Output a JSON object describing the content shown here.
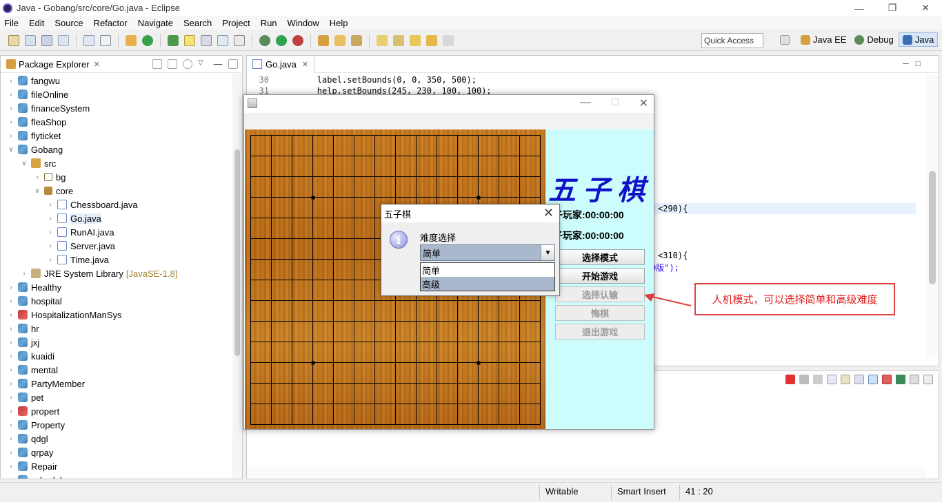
{
  "window": {
    "title": "Java - Gobang/src/core/Go.java - Eclipse"
  },
  "menubar": {
    "items": [
      "File",
      "Edit",
      "Source",
      "Refactor",
      "Navigate",
      "Search",
      "Project",
      "Run",
      "Window",
      "Help"
    ]
  },
  "toolbar": {
    "quick_access": "Quick Access",
    "perspectives": [
      "Java EE",
      "Debug",
      "Java"
    ]
  },
  "package_explorer": {
    "title": "Package Explorer",
    "items": [
      {
        "label": "fangwu",
        "type": "project",
        "depth": 0,
        "expanded": false
      },
      {
        "label": "fileOnline",
        "type": "project",
        "depth": 0,
        "expanded": false
      },
      {
        "label": "financeSystem",
        "type": "project",
        "depth": 0,
        "expanded": false
      },
      {
        "label": "fleaShop",
        "type": "project",
        "depth": 0,
        "expanded": false
      },
      {
        "label": "flyticket",
        "type": "project",
        "depth": 0,
        "expanded": false
      },
      {
        "label": "Gobang",
        "type": "project",
        "depth": 0,
        "expanded": true
      },
      {
        "label": "src",
        "type": "src",
        "depth": 1,
        "expanded": true
      },
      {
        "label": "bg",
        "type": "pkg-empty",
        "depth": 2,
        "expanded": false
      },
      {
        "label": "core",
        "type": "pkg",
        "depth": 2,
        "expanded": true
      },
      {
        "label": "Chessboard.java",
        "type": "java",
        "depth": 3,
        "expanded": false
      },
      {
        "label": "Go.java",
        "type": "java",
        "depth": 3,
        "expanded": false,
        "selected": true
      },
      {
        "label": "RunAI.java",
        "type": "java",
        "depth": 3,
        "expanded": false
      },
      {
        "label": "Server.java",
        "type": "java",
        "depth": 3,
        "expanded": false
      },
      {
        "label": "Time.java",
        "type": "java",
        "depth": 3,
        "expanded": false
      },
      {
        "label": "JRE System Library",
        "sublabel": "[JavaSE-1.8]",
        "type": "lib",
        "depth": 1,
        "expanded": false
      },
      {
        "label": "Healthy",
        "type": "project",
        "depth": 0,
        "expanded": false
      },
      {
        "label": "hospital",
        "type": "project",
        "depth": 0,
        "expanded": false
      },
      {
        "label": "HospitalizationManSys",
        "type": "project-err",
        "depth": 0,
        "expanded": false
      },
      {
        "label": "hr",
        "type": "project",
        "depth": 0,
        "expanded": false
      },
      {
        "label": "jxj",
        "type": "project",
        "depth": 0,
        "expanded": false
      },
      {
        "label": "kuaidi",
        "type": "project",
        "depth": 0,
        "expanded": false
      },
      {
        "label": "mental",
        "type": "project",
        "depth": 0,
        "expanded": false
      },
      {
        "label": "PartyMember",
        "type": "project",
        "depth": 0,
        "expanded": false
      },
      {
        "label": "pet",
        "type": "project",
        "depth": 0,
        "expanded": false
      },
      {
        "label": "propert",
        "type": "project-err",
        "depth": 0,
        "expanded": false
      },
      {
        "label": "Property",
        "type": "project",
        "depth": 0,
        "expanded": false
      },
      {
        "label": "qdgl",
        "type": "project",
        "depth": 0,
        "expanded": false
      },
      {
        "label": "qrpay",
        "type": "project",
        "depth": 0,
        "expanded": false
      },
      {
        "label": "Repair",
        "type": "project",
        "depth": 0,
        "expanded": false
      },
      {
        "label": "schedule",
        "type": "project",
        "depth": 0,
        "expanded": false
      }
    ]
  },
  "editor": {
    "tab": "Go.java",
    "lines": [
      {
        "num": "30",
        "text": "        label.setBounds(0, 0, 350, 500);"
      },
      {
        "num": "31",
        "text": "        help.setBounds(245, 230, 100, 100);"
      }
    ],
    "fragments": [
      {
        "text": "<290){",
        "blue": false
      },
      {
        "text": "<310){",
        "blue": false
      },
      {
        "text": "0版\");",
        "blue": true
      }
    ]
  },
  "statusbar": {
    "writable": "Writable",
    "insert_mode": "Smart Insert",
    "position": "41 : 20"
  },
  "game": {
    "title_art": "五子棋",
    "black_player": "黑子玩家:00:00:00",
    "white_player": "白子玩家:00:00:00",
    "buttons": [
      {
        "label": "选择模式",
        "enabled": true
      },
      {
        "label": "开始游戏",
        "enabled": true
      },
      {
        "label": "选择认输",
        "enabled": false
      },
      {
        "label": "悔棋",
        "enabled": false
      },
      {
        "label": "退出游戏",
        "enabled": false
      }
    ]
  },
  "dialog": {
    "title": "五子棋",
    "prompt": "难度选择",
    "selected": "简单",
    "options": [
      "简单",
      "高级"
    ]
  },
  "annotation": {
    "text": "人机模式，可以选择简单和高级难度"
  }
}
